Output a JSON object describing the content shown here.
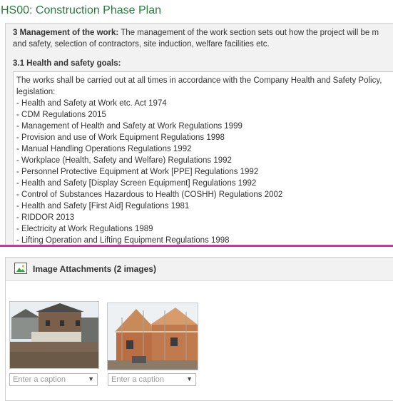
{
  "page": {
    "title": "HS00: Construction Phase Plan"
  },
  "management": {
    "heading": "3 Management of the work:",
    "line1": "The management of the work section sets out how the project will be m",
    "line2": "and safety, selection of contractors, site induction, welfare facilities etc."
  },
  "goals": {
    "label": "3.1 Health and safety goals:",
    "intro1": "The works shall be carried out at all times in accordance with the Company Health and Safety Policy,",
    "intro2": "legislation:",
    "items": [
      "- Health and Safety at Work etc. Act 1974",
      "- CDM Regulations 2015",
      "- Management of Health and Safety at Work Regulations 1999",
      "- Provision and use of Work Equipment Regulations 1998",
      "- Manual Handling Operations Regulations 1992",
      "- Workplace (Health, Safety and Welfare) Regulations 1992",
      "- Personnel Protective Equipment at Work [PPE] Regulations 1992",
      "- Health and Safety [Display Screen Equipment] Regulations 1992",
      "- Control of Substances Hazardous to Health (COSHH) Regulations 2002",
      "- Health and Safety [First Aid] Regulations 1981",
      "- RIDDOR 2013",
      "- Electricity at Work Regulations 1989",
      "- Lifting Operation and Lifting Equipment Regulations 1998"
    ]
  },
  "attachments": {
    "title": "Image Attachments (2 images)",
    "icon": "image-icon",
    "images": [
      {
        "caption_placeholder": "Enter a caption",
        "thumb_icon": "barn-photo"
      },
      {
        "caption_placeholder": "Enter a caption",
        "thumb_icon": "construction-photo"
      }
    ]
  },
  "colors": {
    "title": "#2a7a3e",
    "separator": "#ee1ebd"
  }
}
